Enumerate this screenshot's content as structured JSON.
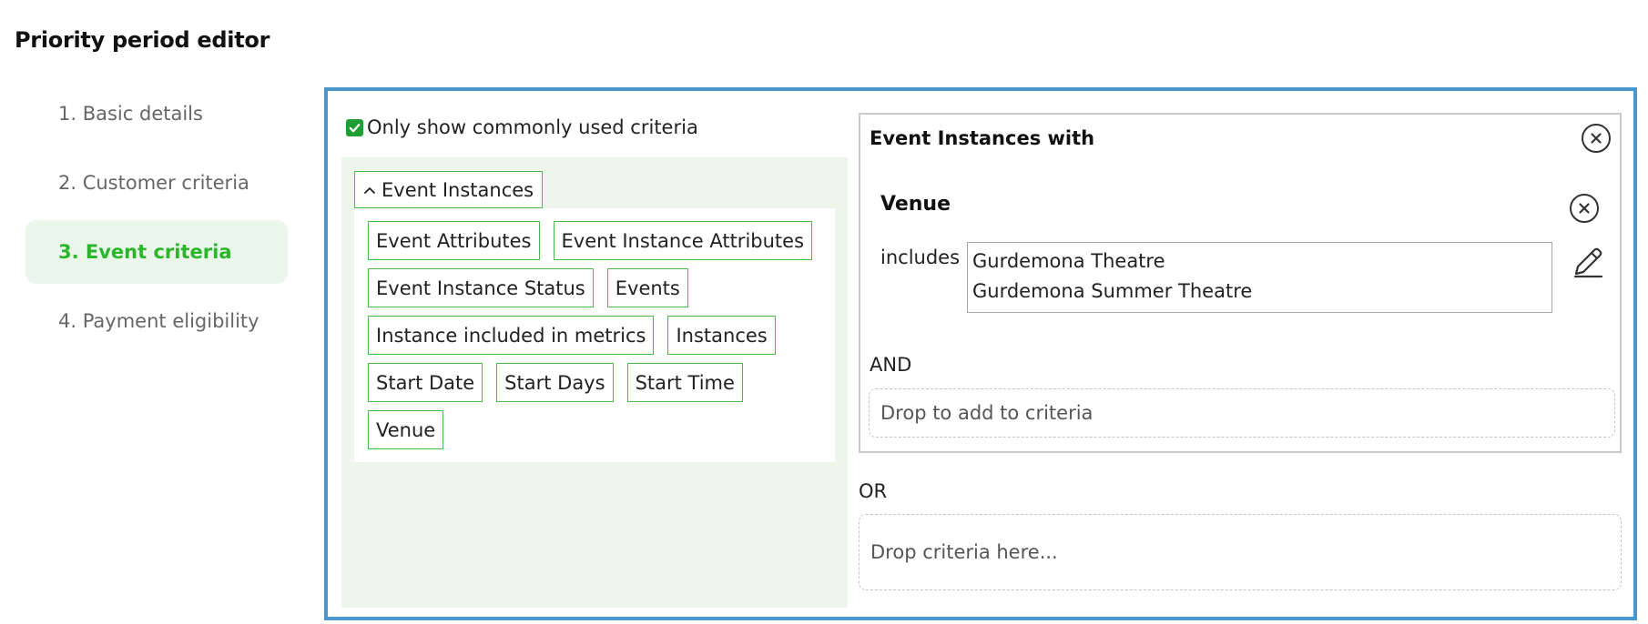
{
  "page_title": "Priority period editor",
  "steps": [
    {
      "label": "1. Basic details"
    },
    {
      "label": "2. Customer criteria"
    },
    {
      "label": "3. Event criteria"
    },
    {
      "label": "4. Payment eligibility"
    }
  ],
  "active_step": 2,
  "palette": {
    "common_only_label": "Only show commonly used criteria",
    "common_only_checked": true,
    "group_label": "Event Instances",
    "group_icon": "chevron-up-icon",
    "chips": [
      "Event Attributes",
      "Event Instance Attributes",
      "Event Instance Status",
      "Events",
      "Instance included in metrics",
      "Instances",
      "Start Date",
      "Start Days",
      "Start Time",
      "Venue"
    ]
  },
  "rule": {
    "title": "Event Instances with",
    "condition": {
      "name": "Venue",
      "operator": "includes",
      "values": [
        "Gurdemona Theatre",
        "Gurdemona Summer Theatre"
      ]
    },
    "and_label": "AND",
    "drop_add_placeholder": "Drop to add to criteria"
  },
  "or_label": "OR",
  "drop_criteria_placeholder": "Drop criteria here...",
  "colors": {
    "accent_green": "#2bb52b",
    "active_step_bg": "#eaf6ea",
    "editor_border": "#4a97cc",
    "chip_border": "#4cba4c",
    "palette_bg": "#eef6ec"
  }
}
